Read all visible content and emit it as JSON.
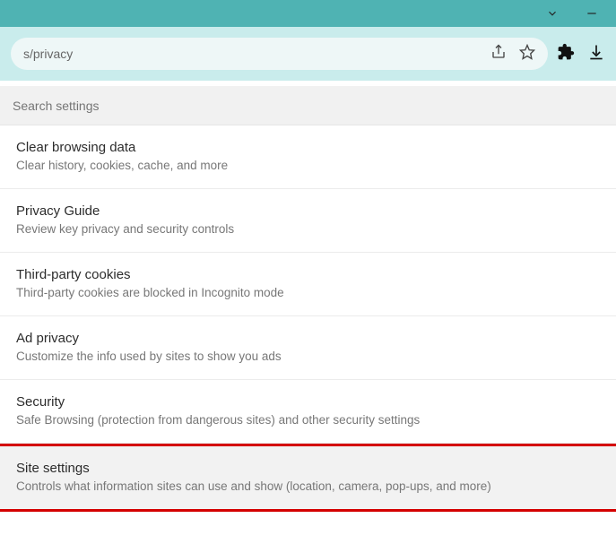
{
  "url": "s/privacy",
  "search": {
    "placeholder": "Search settings"
  },
  "items": [
    {
      "title": "Clear browsing data",
      "desc": "Clear history, cookies, cache, and more"
    },
    {
      "title": "Privacy Guide",
      "desc": "Review key privacy and security controls"
    },
    {
      "title": "Third-party cookies",
      "desc": "Third-party cookies are blocked in Incognito mode"
    },
    {
      "title": "Ad privacy",
      "desc": "Customize the info used by sites to show you ads"
    },
    {
      "title": "Security",
      "desc": "Safe Browsing (protection from dangerous sites) and other security settings"
    },
    {
      "title": "Site settings",
      "desc": "Controls what information sites can use and show (location, camera, pop-ups, and more)"
    }
  ]
}
